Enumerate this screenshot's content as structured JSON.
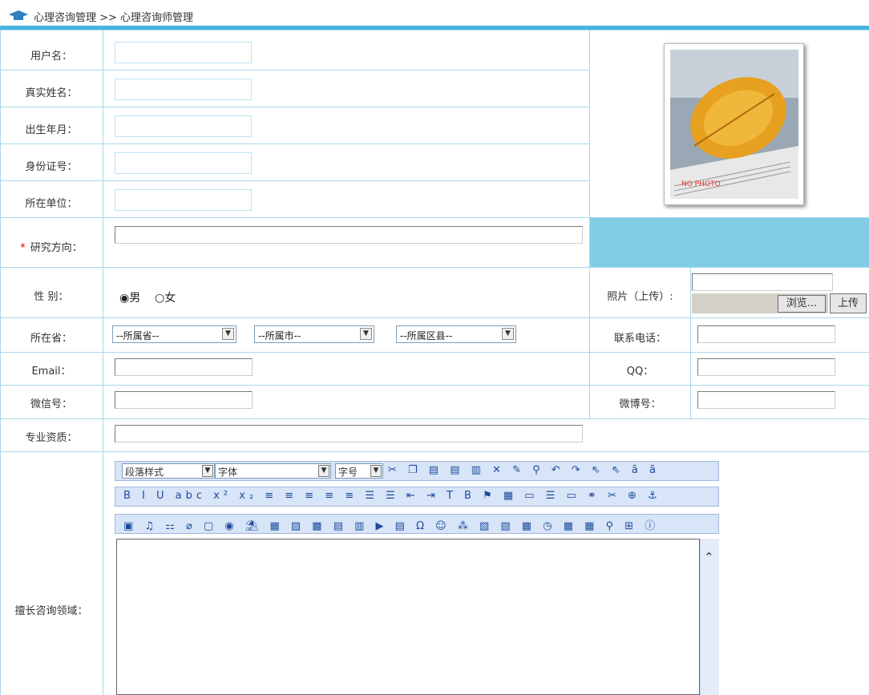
{
  "breadcrumb": "心理咨询管理 >> 心理咨询师管理",
  "labels": {
    "username": "用户名：",
    "realname": "真实姓名：",
    "birth": "出生年月：",
    "idcard": "身份证号：",
    "unit": "所在单位：",
    "research_marker": "*",
    "research": "研究方向：",
    "gender": "性 别：",
    "photo_upload": "照片（上传）:",
    "province": "所在省：",
    "phone": "联系电话：",
    "email": "Email：",
    "qq": "QQ：",
    "wechat": "微信号：",
    "weibo": "微博号：",
    "qualification": "专业资质：",
    "expertise": "擅长咨询领域："
  },
  "photo": {
    "placeholder_text": "NO PHOTO"
  },
  "gender": {
    "male": "男",
    "female": "女",
    "selected": "male"
  },
  "selects": {
    "province": "--所属省--",
    "city": "--所属市--",
    "district": "--所属区县--"
  },
  "buttons": {
    "browse": "浏览...",
    "upload": "上传"
  },
  "editor": {
    "paragraph_style": "段落样式",
    "font": "字体",
    "font_size": "字号",
    "row1_icons": "✂ ❐ ▤ ▤ ▥ ✕ ✎ ⚲ ↶ ↷ ⇖ ⇖ ā ā",
    "row2_icons": "B I U abc x² x₂ ≡ ≡ ≡ ≡ ≡ ☰ ☰ ⇤ ⇥ T B ⚑ ▦ ▭ ☰ ▭ ⚭ ✂ ⊕ ⚓",
    "row3_icons": "▣ ♫ ⚏ ⌀ ▢ ◉ ⛱ ▦ ▨ ▩ ▤ ▥ ▶ ▤ Ω ☺ ⁂ ▧ ▨ ▦ ◷ ▦ ▦ ⚲ ⊞ ⓘ"
  }
}
